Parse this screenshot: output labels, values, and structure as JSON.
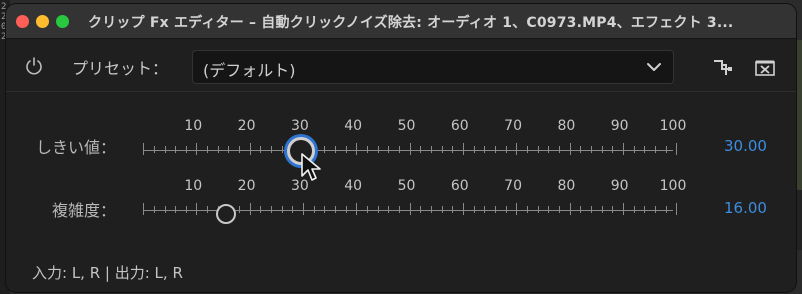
{
  "window": {
    "title": "クリップ Fx エディター – 自動クリックノイズ除去: オーディオ 1、C0973.MP4、エフェクト 3..."
  },
  "toolbar": {
    "preset_label": "プリセット：",
    "preset_value": "(デフォルト)"
  },
  "params": [
    {
      "label": "しきい値：",
      "value_text": "30.00",
      "value": 30,
      "active": true
    },
    {
      "label": "複雑度：",
      "value_text": "16.00",
      "value": 16,
      "active": false
    }
  ],
  "scale": {
    "min": 0,
    "max": 100,
    "labels": [
      "10",
      "20",
      "30",
      "40",
      "50",
      "60",
      "70",
      "80",
      "90",
      "100"
    ]
  },
  "footer": {
    "io_text": "入力: L, R | 出力: L, R"
  },
  "colors": {
    "accent": "#3d8de0",
    "focus_ring": "#2f74d0"
  },
  "icons": {
    "power": "power-icon",
    "chevron": "chevron-down-icon",
    "reorder": "routing-icon",
    "delete": "delete-icon",
    "cursor": "mouse-pointer-icon"
  }
}
